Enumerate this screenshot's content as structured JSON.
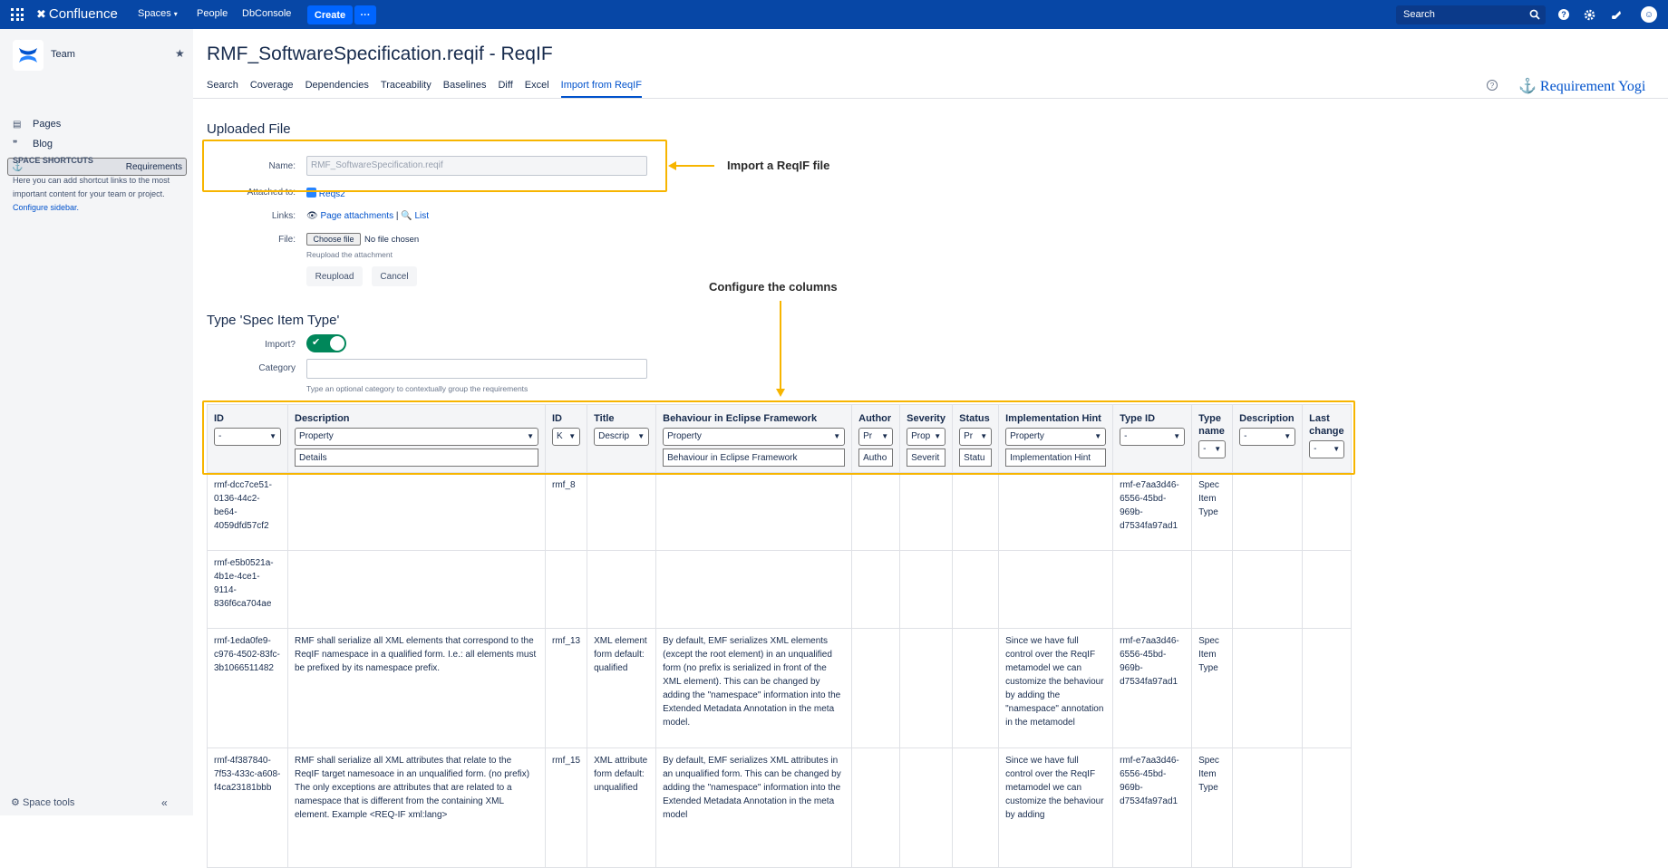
{
  "topnav": {
    "product": "Confluence",
    "spaces": "Spaces",
    "people": "People",
    "dbconsole": "DbConsole",
    "create": "Create",
    "more": "···",
    "search_placeholder": "Search"
  },
  "sidebar": {
    "space_name": "Team",
    "items": [
      {
        "label": "Pages",
        "icon": "pages-icon"
      },
      {
        "label": "Blog",
        "icon": "blog-icon"
      },
      {
        "label": "Requirements",
        "icon": "requirements-icon",
        "selected": true
      }
    ],
    "shortcuts_title": "SPACE SHORTCUTS",
    "shortcuts_text": "Here you can add shortcut links to the most important content for your team or project.",
    "configure_link": "Configure sidebar.",
    "space_tools": "Space tools"
  },
  "page": {
    "title": "RMF_SoftwareSpecification.reqif - ReqIF",
    "tabs": [
      "Search",
      "Coverage",
      "Dependencies",
      "Traceability",
      "Baselines",
      "Diff",
      "Excel",
      "Import from ReqIF"
    ],
    "active_tab": "Import from ReqIF",
    "brand": "Requirement Yogi"
  },
  "uploaded": {
    "heading": "Uploaded File",
    "name_label": "Name:",
    "name_value": "RMF_SoftwareSpecification.reqif",
    "attached_label": "Attached to:",
    "attached_value": "Reqs2",
    "links_label": "Links:",
    "link_attachments": "Page attachments",
    "link_sep": "|",
    "link_list": "List",
    "file_label": "File:",
    "choose_file": "Choose file",
    "no_file": "No file chosen",
    "reupload_hint": "Reupload the attachment",
    "reupload_btn": "Reupload",
    "cancel_btn": "Cancel"
  },
  "type_section": {
    "heading": "Type 'Spec Item Type'",
    "import_label": "Import?",
    "category_label": "Category",
    "category_hint": "Type an optional category to contextually group the requirements"
  },
  "annotations": {
    "import_reqif": "Import a ReqIF file",
    "configure_columns": "Configure the columns"
  },
  "table": {
    "columns": [
      {
        "header": "ID",
        "select": "-",
        "input": ""
      },
      {
        "header": "Description",
        "select": "Property",
        "input": "Details"
      },
      {
        "header": "ID",
        "select": "K",
        "input": ""
      },
      {
        "header": "Title",
        "select": "Descrip",
        "input": ""
      },
      {
        "header": "Behaviour in Eclipse Framework",
        "select": "Property",
        "input": "Behaviour in Eclipse Framework"
      },
      {
        "header": "Author",
        "select": "Pr",
        "input": "Autho"
      },
      {
        "header": "Severity",
        "select": "Prop",
        "input": "Severit"
      },
      {
        "header": "Status",
        "select": "Pr",
        "input": "Statu"
      },
      {
        "header": "Implementation Hint",
        "select": "Property",
        "input": "Implementation Hint"
      },
      {
        "header": "Type ID",
        "select": "-",
        "input": ""
      },
      {
        "header": "Type name",
        "select": "-",
        "input": ""
      },
      {
        "header": "Description",
        "select": "-",
        "input": ""
      },
      {
        "header": "Last change",
        "select": "-",
        "input": ""
      }
    ],
    "rows": [
      [
        "rmf-dcc7ce51-0136-44c2-be64-4059dfd57cf2",
        "",
        "rmf_8",
        "",
        "",
        "",
        "",
        "",
        "",
        "rmf-e7aa3d46-6556-45bd-969b-d7534fa97ad1",
        "Spec Item Type",
        "",
        ""
      ],
      [
        "rmf-e5b0521a-4b1e-4ce1-9114-836f6ca704ae",
        "",
        "",
        "",
        "",
        "",
        "",
        "",
        "",
        "",
        "",
        "",
        ""
      ],
      [
        "rmf-1eda0fe9-c976-4502-83fc-3b1066511482",
        "RMF shall serialize all XML elements that correspond to the ReqIF namespace in a qualified form. I.e.: all elements must be prefixed by its namespace prefix.",
        "rmf_13",
        "XML element form default: qualified",
        "By default, EMF serializes XML elements (except the root element) in an unqualified form (no prefix is serialized in front of the XML element). This can be changed by adding the \"namespace\" information into the Extended Metadata Annotation in the meta model.",
        "",
        "",
        "",
        "Since we have full control over the ReqIF metamodel we can customize the behaviour by adding the \"namespace\" annotation in the metamodel",
        "rmf-e7aa3d46-6556-45bd-969b-d7534fa97ad1",
        "Spec Item Type",
        "",
        ""
      ],
      [
        "rmf-4f387840-7f53-433c-a608-f4ca23181bbb",
        "RMF shall serialize all XML attributes that relate to the ReqIF target namesoace in an unqualified form. (no prefix) The only exceptions are attributes that are related to a namespace that is different from the containing XML element. Example <REQ-IF xml:lang>",
        "rmf_15",
        "XML attribute form default: unqualified",
        "By default, EMF serializes XML attributes in an unqualified form. This can be changed by adding the \"namespace\" information into the Extended Metadata Annotation in the meta model",
        "",
        "",
        "",
        "Since we have full control over the ReqIF metamodel we can customize the behaviour by adding",
        "rmf-e7aa3d46-6556-45bd-969b-d7534fa97ad1",
        "Spec Item Type",
        "",
        ""
      ]
    ]
  }
}
